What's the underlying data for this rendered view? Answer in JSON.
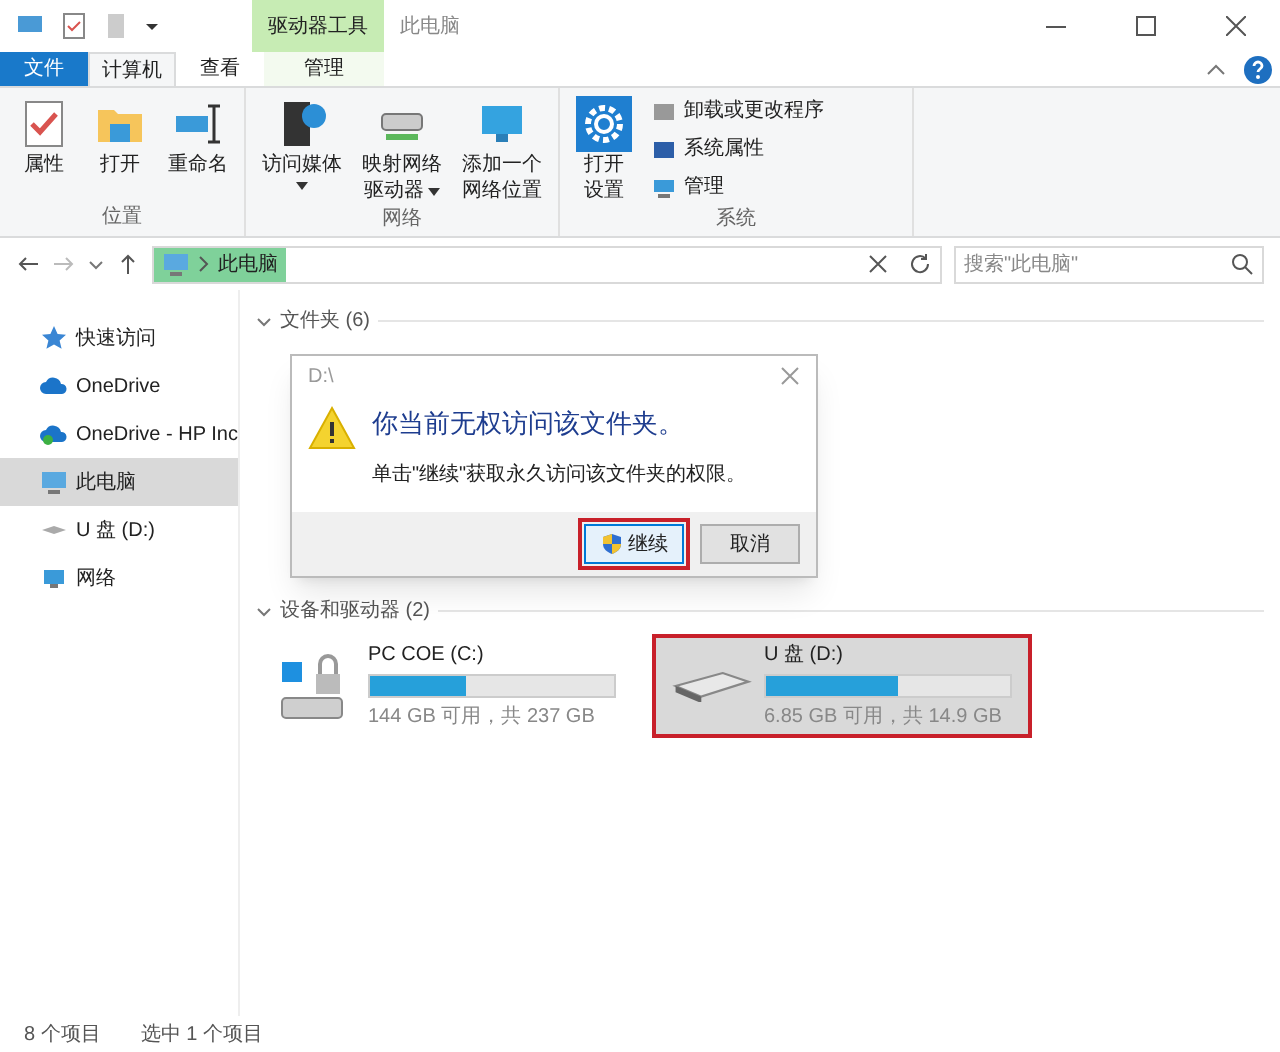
{
  "title_bar": {
    "contextual_tab": "驱动器工具",
    "title": "此电脑"
  },
  "ribbon_tabs": [
    {
      "label": "文件",
      "kind": "file",
      "selected": false
    },
    {
      "label": "计算机",
      "kind": "plain",
      "selected": true
    },
    {
      "label": "查看",
      "kind": "plain",
      "selected": false
    },
    {
      "label": "管理",
      "kind": "contextual",
      "selected": false
    }
  ],
  "ribbon_groups": [
    {
      "label": "位置",
      "buttons": [
        {
          "lines": [
            "属性"
          ],
          "kind": "properties",
          "dropdown": false
        },
        {
          "lines": [
            "打开"
          ],
          "kind": "open",
          "dropdown": false
        },
        {
          "lines": [
            "重命名"
          ],
          "kind": "rename",
          "dropdown": false
        }
      ]
    },
    {
      "label": "网络",
      "buttons": [
        {
          "lines": [
            "访问媒体"
          ],
          "kind": "media",
          "dropdown": true
        },
        {
          "lines": [
            "映射网络",
            "驱动器"
          ],
          "kind": "drive",
          "dropdown": true
        },
        {
          "lines": [
            "添加一个",
            "网络位置"
          ],
          "kind": "monitor",
          "dropdown": false
        }
      ]
    },
    {
      "label": "系统",
      "buttons": [
        {
          "lines": [
            "打开",
            "设置"
          ],
          "kind": "settings",
          "dropdown": false
        }
      ],
      "small_buttons": [
        {
          "label": "卸载或更改程序",
          "kind": "uninstall"
        },
        {
          "label": "系统属性",
          "kind": "sysprops"
        },
        {
          "label": "管理",
          "kind": "manage"
        }
      ]
    }
  ],
  "address": {
    "path": "此电脑",
    "search_placeholder": "搜索\"此电脑\""
  },
  "sidebar": {
    "items": [
      {
        "label": "快速访问",
        "kind": "star",
        "selected": false
      },
      {
        "label": "OneDrive",
        "kind": "cloud",
        "selected": false
      },
      {
        "label": "OneDrive - HP Inc",
        "kind": "cloud-green",
        "selected": false
      },
      {
        "label": "此电脑",
        "kind": "pc",
        "selected": true
      },
      {
        "label": "U 盘 (D:)",
        "kind": "usb",
        "selected": false
      },
      {
        "label": "网络",
        "kind": "network",
        "selected": false
      }
    ]
  },
  "sections": {
    "folders": "文件夹 (6)",
    "devices": "设备和驱动器 (2)"
  },
  "drives": [
    {
      "name": "PC COE (C:)",
      "free": "144 GB 可用，共 237 GB",
      "level": 0.39,
      "kind": "system",
      "selected": false
    },
    {
      "name": "U 盘 (D:)",
      "free": "6.85 GB 可用，共 14.9 GB",
      "level": 0.54,
      "kind": "usb",
      "selected": true
    }
  ],
  "dialog": {
    "title": "D:\\",
    "heading": "你当前无权访问该文件夹。",
    "message": "单击\"继续\"获取永久访问该文件夹的权限。",
    "buttons": [
      {
        "label": "继续",
        "kind": "shield",
        "selected": true
      },
      {
        "label": "取消",
        "kind": "plain",
        "selected": false
      }
    ]
  },
  "status_bar": [
    "8 个项目",
    "选中 1 个项目"
  ]
}
